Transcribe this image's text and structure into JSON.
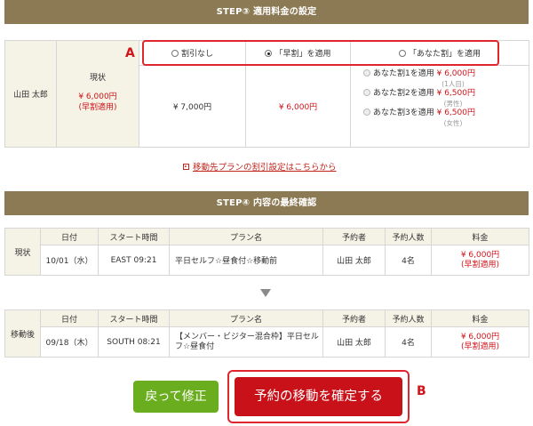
{
  "step3": {
    "title": "STEP③ 適用料金の設定",
    "options": [
      "割引なし",
      "「早割」を適用",
      "「あなた割」を適用"
    ],
    "selected_index": 1,
    "member_name": "山田 太郎",
    "current_label": "現状",
    "current_price": "¥ 6,000円",
    "current_note": "(早割適用)",
    "price_none": "¥ 7,000円",
    "price_early": "¥ 6,000円",
    "anata_options": [
      {
        "label": "あなた割1を適用",
        "price": "¥ 6,000円",
        "note": "(1人目)"
      },
      {
        "label": "あなた割2を適用",
        "price": "¥ 6,500円",
        "note": "(男性)"
      },
      {
        "label": "あなた割3を適用",
        "price": "¥ 6,500円",
        "note": "(女性)"
      }
    ]
  },
  "link_text": "移動先プランの割引設定はこちらから",
  "step4": {
    "title": "STEP④ 内容の最終確認",
    "headers": [
      "日付",
      "スタート時間",
      "プラン名",
      "予約者",
      "予約人数",
      "料金"
    ],
    "current": {
      "label": "現状",
      "date": "10/01（水）",
      "start": "EAST 09:21",
      "plan": "平日セルフ☆昼食付☆移動前",
      "booker": "山田 太郎",
      "count": "4名",
      "price": "¥ 6,000円",
      "price_note": "(早割適用)"
    },
    "after": {
      "label": "移動後",
      "date": "09/18（木）",
      "start": "SOUTH 08:21",
      "plan": "【メンバー・ビジター混合枠】平日セルフ☆昼食付",
      "booker": "山田 太郎",
      "count": "4名",
      "price": "¥ 6,000円",
      "price_note": "(早割適用)"
    }
  },
  "buttons": {
    "back": "戻って修正",
    "confirm": "予約の移動を確定する"
  },
  "annotations": {
    "a": "A",
    "b": "B"
  },
  "colors": {
    "header_bar": "#8c7a55",
    "accent_red": "#d0141a",
    "back_green": "#6aad1e",
    "confirm_red": "#c9111a"
  }
}
